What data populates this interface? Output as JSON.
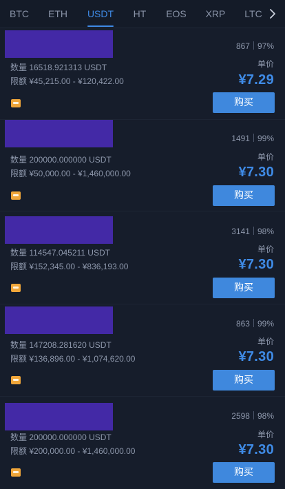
{
  "tabs": [
    {
      "label": "BTC"
    },
    {
      "label": "ETH"
    },
    {
      "label": "USDT",
      "active": true
    },
    {
      "label": "HT"
    },
    {
      "label": "EOS"
    },
    {
      "label": "XRP"
    },
    {
      "label": "LTC"
    }
  ],
  "more_icon": "chevron-right-icon",
  "colors": {
    "accent": "#3f8be6",
    "background": "#161d2b",
    "avatar_redaction": "#4329a6",
    "payment_icon": "#f0a63a"
  },
  "offers": [
    {
      "orders": "867",
      "completion": "97%",
      "quantity": "数量 16518.921313 USDT",
      "limit": "限额 ¥45,215.00 - ¥120,422.00",
      "price_label": "单价",
      "price": "¥7.29",
      "buy_label": "购买"
    },
    {
      "orders": "1491",
      "completion": "99%",
      "quantity": "数量 200000.000000 USDT",
      "limit": "限额 ¥50,000.00 - ¥1,460,000.00",
      "price_label": "单价",
      "price": "¥7.30",
      "buy_label": "购买"
    },
    {
      "orders": "3141",
      "completion": "98%",
      "quantity": "数量 114547.045211 USDT",
      "limit": "限额 ¥152,345.00 - ¥836,193.00",
      "price_label": "单价",
      "price": "¥7.30",
      "buy_label": "购买"
    },
    {
      "orders": "863",
      "completion": "99%",
      "quantity": "数量 147208.281620 USDT",
      "limit": "限额 ¥136,896.00 - ¥1,074,620.00",
      "price_label": "单价",
      "price": "¥7.30",
      "buy_label": "购买"
    },
    {
      "orders": "2598",
      "completion": "98%",
      "quantity": "数量 200000.000000 USDT",
      "limit": "限额 ¥200,000.00 - ¥1,460,000.00",
      "price_label": "单价",
      "price": "¥7.30",
      "buy_label": "购买"
    }
  ]
}
